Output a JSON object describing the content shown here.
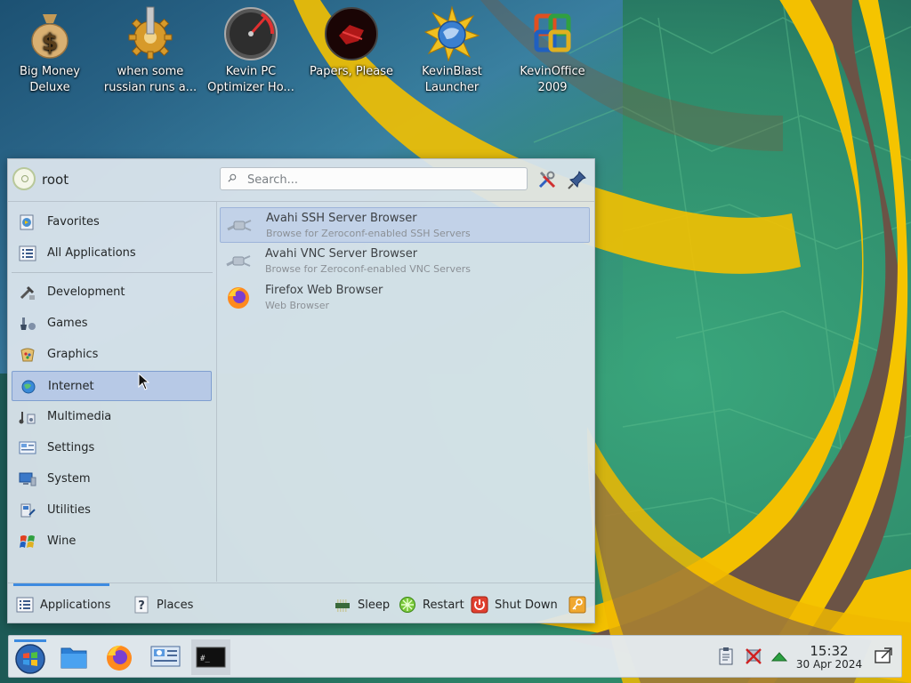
{
  "desktop": {
    "icons": [
      {
        "label": "Big Money\nDeluxe",
        "line1": "Big Money",
        "line2": "Deluxe",
        "icon": "money-bag-icon"
      },
      {
        "label": "when some russian runs a...",
        "line1": "when some",
        "line2": "russian runs a...",
        "icon": "gear-icon"
      },
      {
        "label": "Kevin PC Optimizer Ho...",
        "line1": "Kevin PC",
        "line2": "Optimizer Ho...",
        "icon": "gauge-icon"
      },
      {
        "label": "Papers, Please",
        "line1": "Papers, Please",
        "line2": "",
        "icon": "papers-please-icon"
      },
      {
        "label": "KevinBlast Launcher",
        "line1": "KevinBlast",
        "line2": "Launcher",
        "icon": "globe-burst-icon"
      },
      {
        "label": "KevinOffice 2009",
        "line1": "KevinOffice",
        "line2": "2009",
        "icon": "office-icon"
      }
    ]
  },
  "launcher": {
    "user": "root",
    "search_placeholder": "Search...",
    "categories_top": [
      {
        "label": "Favorites",
        "icon": "favorites-icon"
      },
      {
        "label": "All Applications",
        "icon": "all-applications-icon"
      }
    ],
    "categories": [
      {
        "label": "Development",
        "icon": "development-icon"
      },
      {
        "label": "Games",
        "icon": "games-icon"
      },
      {
        "label": "Graphics",
        "icon": "graphics-icon"
      },
      {
        "label": "Internet",
        "icon": "internet-icon",
        "active": true
      },
      {
        "label": "Multimedia",
        "icon": "multimedia-icon"
      },
      {
        "label": "Settings",
        "icon": "settings-icon"
      },
      {
        "label": "System",
        "icon": "system-icon"
      },
      {
        "label": "Utilities",
        "icon": "utilities-icon"
      },
      {
        "label": "Wine",
        "icon": "wine-icon"
      }
    ],
    "apps": [
      {
        "name": "Avahi SSH Server Browser",
        "desc": "Browse for Zeroconf-enabled SSH Servers",
        "icon": "network-plug-icon"
      },
      {
        "name": "Avahi VNC Server Browser",
        "desc": "Browse for Zeroconf-enabled VNC Servers",
        "icon": "network-plug-icon"
      },
      {
        "name": "Firefox Web Browser",
        "desc": "Web Browser",
        "icon": "firefox-icon"
      }
    ],
    "footer": {
      "applications": "Applications",
      "places": "Places",
      "sleep": "Sleep",
      "restart": "Restart",
      "shutdown": "Shut Down"
    }
  },
  "taskbar": {
    "clock_time": "15:32",
    "clock_date": "30 Apr 2024",
    "terminal_text": "#_"
  },
  "colors": {
    "accent": "#3d8be0",
    "selection": "#b7c9e6",
    "wallpaper_green": "#2f8f6c",
    "wallpaper_gold": "#f5c400",
    "wallpaper_brown": "#6b5346"
  }
}
